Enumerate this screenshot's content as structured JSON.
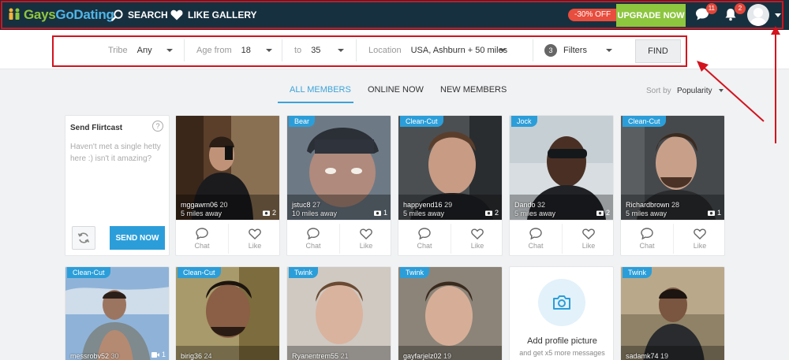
{
  "header": {
    "logo": {
      "part1": "Gays",
      "part2": "GoDating"
    },
    "nav": {
      "search": "SEARCH",
      "like_gallery": "LIKE GALLERY"
    },
    "discount": "-30% OFF",
    "upgrade": "UPGRADE NOW",
    "messages_count": "11",
    "notifications_count": "2"
  },
  "filters": {
    "tribe": {
      "label": "Tribe",
      "value": "Any"
    },
    "age_from": {
      "label": "Age from",
      "value": "18"
    },
    "age_to": {
      "label": "to",
      "value": "35"
    },
    "location": {
      "label": "Location",
      "value": "USA, Ashburn + 50 miles"
    },
    "filters": {
      "count": "3",
      "label": "Filters"
    },
    "find": "FIND"
  },
  "tabs": [
    "ALL MEMBERS",
    "ONLINE NOW",
    "NEW MEMBERS"
  ],
  "sort": {
    "label": "Sort by",
    "value": "Popularity"
  },
  "flirtcast": {
    "title": "Send Flirtcast",
    "help": "?",
    "message": "Haven't met a single hetty here :) isn't it amazing?",
    "send": "SEND NOW"
  },
  "actions": {
    "chat": "Chat",
    "like": "Like"
  },
  "members_top": [
    {
      "name": "mggawrn06",
      "age": "20",
      "distance": "5 miles away",
      "photos": "2",
      "tag": ""
    },
    {
      "name": "jstuc8",
      "age": "27",
      "distance": "10 miles away",
      "photos": "1",
      "tag": "Bear"
    },
    {
      "name": "happyend16",
      "age": "29",
      "distance": "5 miles away",
      "photos": "2",
      "tag": "Clean-Cut"
    },
    {
      "name": "Dando",
      "age": "32",
      "distance": "5 miles away",
      "photos": "2",
      "tag": "Jock"
    },
    {
      "name": "Richardbrown",
      "age": "28",
      "distance": "5 miles away",
      "photos": "1",
      "tag": "Clean-Cut"
    }
  ],
  "members_bottom": [
    {
      "name": "messrobv52",
      "age": "30",
      "photos": "1",
      "tag": "Clean-Cut"
    },
    {
      "name": "birig36",
      "age": "24",
      "photos": "",
      "tag": "Clean-Cut"
    },
    {
      "name": "Ryanentrem55",
      "age": "21",
      "photos": "",
      "tag": "Twink"
    },
    {
      "name": "gayfarjelz02",
      "age": "19",
      "photos": "",
      "tag": "Twink"
    },
    {
      "name": "sadamk74",
      "age": "19",
      "photos": "",
      "tag": "Twink"
    }
  ],
  "add_picture": {
    "title": "Add profile picture",
    "subtitle": "and get x5 more messages"
  },
  "colors": {
    "header_bg": "#17303f",
    "accent": "#2b9ed9",
    "upgrade": "#8dc63f",
    "annotation_red": "#d3131e"
  }
}
